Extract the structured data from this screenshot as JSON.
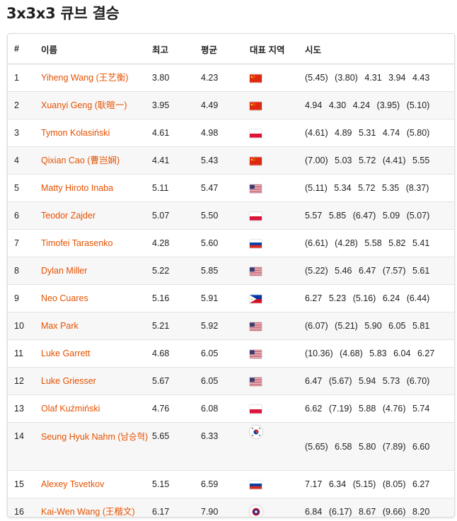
{
  "page": {
    "title": "3x3x3 큐브 결승"
  },
  "table": {
    "headers": {
      "rank": "#",
      "name": "이름",
      "best": "최고",
      "average": "평균",
      "region": "대표 지역",
      "attempts": "시도"
    },
    "rows": [
      {
        "rank": "1",
        "name": "Yiheng Wang (王艺衡)",
        "best": "3.80",
        "average": "4.23",
        "flag": "cn",
        "attempts": [
          "(5.45)",
          "(3.80)",
          "4.31",
          "3.94",
          "4.43"
        ]
      },
      {
        "rank": "2",
        "name": "Xuanyi Geng (耿暄一)",
        "best": "3.95",
        "average": "4.49",
        "flag": "cn",
        "attempts": [
          "4.94",
          "4.30",
          "4.24",
          "(3.95)",
          "(5.10)"
        ]
      },
      {
        "rank": "3",
        "name": "Tymon Kolasiński",
        "best": "4.61",
        "average": "4.98",
        "flag": "pl",
        "attempts": [
          "(4.61)",
          "4.89",
          "5.31",
          "4.74",
          "(5.80)"
        ]
      },
      {
        "rank": "4",
        "name": "Qixian Cao (曹岂娴)",
        "best": "4.41",
        "average": "5.43",
        "flag": "cn",
        "attempts": [
          "(7.00)",
          "5.03",
          "5.72",
          "(4.41)",
          "5.55"
        ]
      },
      {
        "rank": "5",
        "name": "Matty Hiroto Inaba",
        "best": "5.11",
        "average": "5.47",
        "flag": "us",
        "attempts": [
          "(5.11)",
          "5.34",
          "5.72",
          "5.35",
          "(8.37)"
        ]
      },
      {
        "rank": "6",
        "name": "Teodor Zajder",
        "best": "5.07",
        "average": "5.50",
        "flag": "pl",
        "attempts": [
          "5.57",
          "5.85",
          "(6.47)",
          "5.09",
          "(5.07)"
        ]
      },
      {
        "rank": "7",
        "name": "Timofei Tarasenko",
        "best": "4.28",
        "average": "5.60",
        "flag": "ru",
        "attempts": [
          "(6.61)",
          "(4.28)",
          "5.58",
          "5.82",
          "5.41"
        ]
      },
      {
        "rank": "8",
        "name": "Dylan Miller",
        "best": "5.22",
        "average": "5.85",
        "flag": "us",
        "attempts": [
          "(5.22)",
          "5.46",
          "6.47",
          "(7.57)",
          "5.61"
        ]
      },
      {
        "rank": "9",
        "name": "Neo Cuares",
        "best": "5.16",
        "average": "5.91",
        "flag": "ph",
        "attempts": [
          "6.27",
          "5.23",
          "(5.16)",
          "6.24",
          "(6.44)"
        ]
      },
      {
        "rank": "10",
        "name": "Max Park",
        "best": "5.21",
        "average": "5.92",
        "flag": "us",
        "attempts": [
          "(6.07)",
          "(5.21)",
          "5.90",
          "6.05",
          "5.81"
        ]
      },
      {
        "rank": "11",
        "name": "Luke Garrett",
        "best": "4.68",
        "average": "6.05",
        "flag": "us",
        "attempts": [
          "(10.36)",
          "(4.68)",
          "5.83",
          "6.04",
          "6.27"
        ]
      },
      {
        "rank": "12",
        "name": "Luke Griesser",
        "best": "5.67",
        "average": "6.05",
        "flag": "us",
        "attempts": [
          "6.47",
          "(5.67)",
          "5.94",
          "5.73",
          "(6.70)"
        ]
      },
      {
        "rank": "13",
        "name": "Olaf Kuźmiński",
        "best": "4.76",
        "average": "6.08",
        "flag": "pl",
        "attempts": [
          "6.62",
          "(7.19)",
          "5.88",
          "(4.76)",
          "5.74"
        ]
      },
      {
        "rank": "14",
        "name": "Seung Hyuk Nahm (남승혁)",
        "best": "5.65",
        "average": "6.33",
        "flag": "kr",
        "attempts": [
          "(5.65)",
          "6.58",
          "5.80",
          "(7.89)",
          "6.60"
        ]
      },
      {
        "rank": "15",
        "name": "Alexey Tsvetkov",
        "best": "5.15",
        "average": "6.59",
        "flag": "ru",
        "attempts": [
          "7.17",
          "6.34",
          "(5.15)",
          "(8.05)",
          "6.27"
        ]
      },
      {
        "rank": "16",
        "name": "Kai-Wen Wang (王楷文)",
        "best": "6.17",
        "average": "7.90",
        "flag": "tw",
        "attempts": [
          "6.84",
          "(6.17)",
          "8.67",
          "(9.66)",
          "8.20"
        ]
      }
    ]
  },
  "colors": {
    "link": "#e65100",
    "text": "#212121",
    "row_alt": "#f7f7f7",
    "border": "#dcdcdc"
  }
}
